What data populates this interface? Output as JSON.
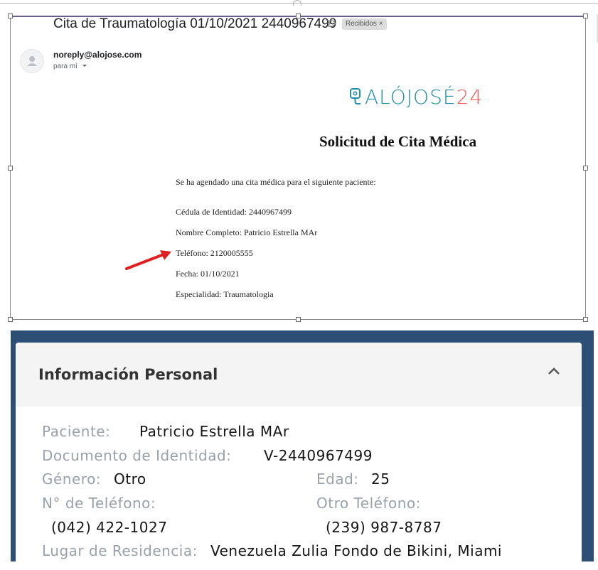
{
  "email": {
    "subject": "Cita de Traumatología 01/10/2021 2440967499",
    "label": "Recibidos",
    "label_close": "×",
    "sender": "noreply@alojose.com",
    "to": "para mí",
    "logo": {
      "part1": "ALÓJOSÉ",
      "part2": "24"
    },
    "title": "Solicitud de Cita Médica",
    "intro": "Se ha agendado una cita médica para el siguiente paciente:",
    "fields": {
      "cedula": "Cédula de Identidad: 2440967499",
      "nombre": "Nombre Completo: Patricio Estrella MAr",
      "telefono": "Teléfono: 2120005555",
      "fecha": "Fecha: 01/10/2021",
      "especialidad": "Especialidad: Traumatologia"
    }
  },
  "personal_info": {
    "title": "Información Personal",
    "paciente_label": "Paciente:",
    "paciente": "Patricio Estrella MAr",
    "documento_label": "Documento de Identidad:",
    "documento": "V-2440967499",
    "genero_label": "Género:",
    "genero": "Otro",
    "edad_label": "Edad:",
    "edad": "25",
    "telefono_label": "N° de Teléfono:",
    "telefono": "(042) 422-1027",
    "otro_telefono_label": "Otro Teléfono:",
    "otro_telefono": "(239) 987-8787",
    "residencia_label": "Lugar de Residencia:",
    "residencia": "Venezuela Zulia Fondo de Bikini, Miami"
  },
  "colors": {
    "panel": "#2d4f76",
    "logo_primary": "#1f8ea7",
    "logo_accent": "#ef5e58",
    "annotation_arrow": "#e02020"
  }
}
